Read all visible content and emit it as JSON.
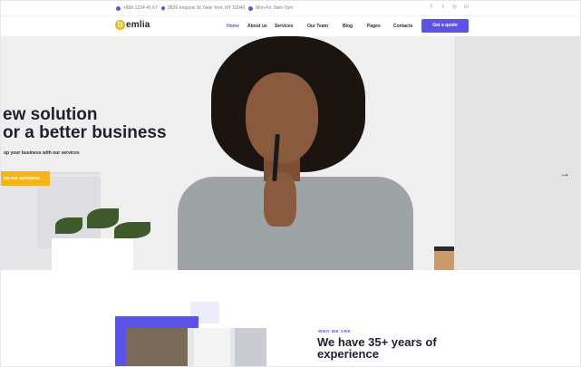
{
  "topbar": {
    "phone": "+880 1234 45 67",
    "address": "3826 Iroquois St, New York, NY 10040",
    "hours": "Mon-Fri: 8am-7pm"
  },
  "social": [
    "facebook-icon",
    "twitter-icon",
    "instagram-icon",
    "linkedin-icon"
  ],
  "brand": {
    "badge": "D",
    "name": "emlia",
    "color": "#f6b41a"
  },
  "menu": [
    {
      "label": "Home",
      "active": true
    },
    {
      "label": "About us"
    },
    {
      "label": "Services",
      "dropdown": true
    },
    {
      "label": "Our Team",
      "dropdown": true
    },
    {
      "label": "Blog",
      "dropdown": true
    },
    {
      "label": "Pages",
      "dropdown": true
    },
    {
      "label": "Contacts"
    }
  ],
  "cta": {
    "label": "Get a quote",
    "color": "#5b52e8"
  },
  "hero": {
    "title_line1": "ew solution",
    "title_line2": "or a better business",
    "subtitle": "up your business with our services",
    "button": "ew our solutions",
    "next_arrow": "→"
  },
  "about": {
    "eyebrow": "WHO WE ARE",
    "title": "We have 35+ years of experience"
  },
  "colors": {
    "accent": "#5b52e8",
    "yellow": "#f6b41a"
  }
}
